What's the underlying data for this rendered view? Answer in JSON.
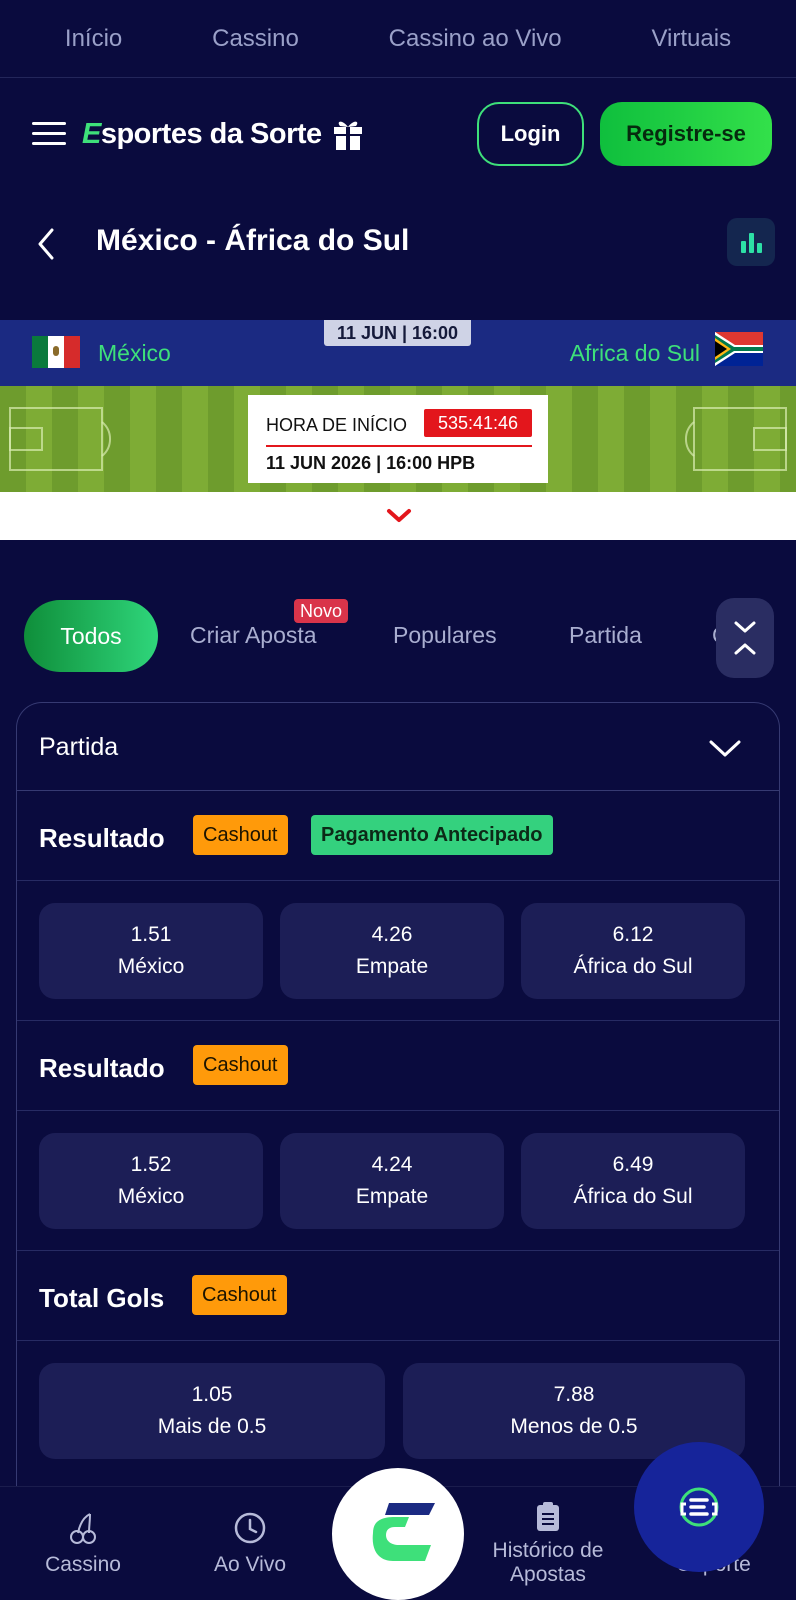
{
  "top_nav": [
    "Início",
    "Cassino",
    "Cassino ao Vivo",
    "Virtuais"
  ],
  "header": {
    "logo_e": "E",
    "logo_text": "sportes da Sorte",
    "login_label": "Login",
    "register_label": "Registre-se"
  },
  "match": {
    "title": "México - África do Sul",
    "date_tag": "11 JUN | 16:00",
    "home_team": "México",
    "away_team": "Africa do Sul",
    "start_label": "HORA DE INÍCIO",
    "countdown": "535:41:46",
    "start_datetime": "11 JUN 2026 | 16:00 HPB"
  },
  "tabs": {
    "active": "Todos",
    "items": [
      "Criar Aposta",
      "Populares",
      "Partida",
      "G"
    ],
    "new_badge": "Novo"
  },
  "panel": {
    "title": "Partida"
  },
  "markets": [
    {
      "title": "Resultado",
      "chips": [
        "Cashout",
        "Pagamento Antecipado"
      ],
      "odds": [
        {
          "value": "1.51",
          "label": "México"
        },
        {
          "value": "4.26",
          "label": "Empate"
        },
        {
          "value": "6.12",
          "label": "África do Sul"
        }
      ]
    },
    {
      "title": "Resultado",
      "chips": [
        "Cashout"
      ],
      "odds": [
        {
          "value": "1.52",
          "label": "México"
        },
        {
          "value": "4.24",
          "label": "Empate"
        },
        {
          "value": "6.49",
          "label": "África do Sul"
        }
      ]
    },
    {
      "title": "Total Gols",
      "chips": [
        "Cashout"
      ],
      "odds": [
        {
          "value": "1.05",
          "label": "Mais de 0.5"
        },
        {
          "value": "7.88",
          "label": "Menos de 0.5"
        }
      ]
    }
  ],
  "bottom_nav": {
    "casino": "Cassino",
    "live": "Ao Vivo",
    "history_line1": "Histórico de",
    "history_line2": "Apostas",
    "support": "Suporte"
  },
  "colors": {
    "background": "#0a0b3e",
    "accent_green": "#3ee07a",
    "cashout_orange": "#ff9a0a",
    "live_red": "#e3161c"
  }
}
